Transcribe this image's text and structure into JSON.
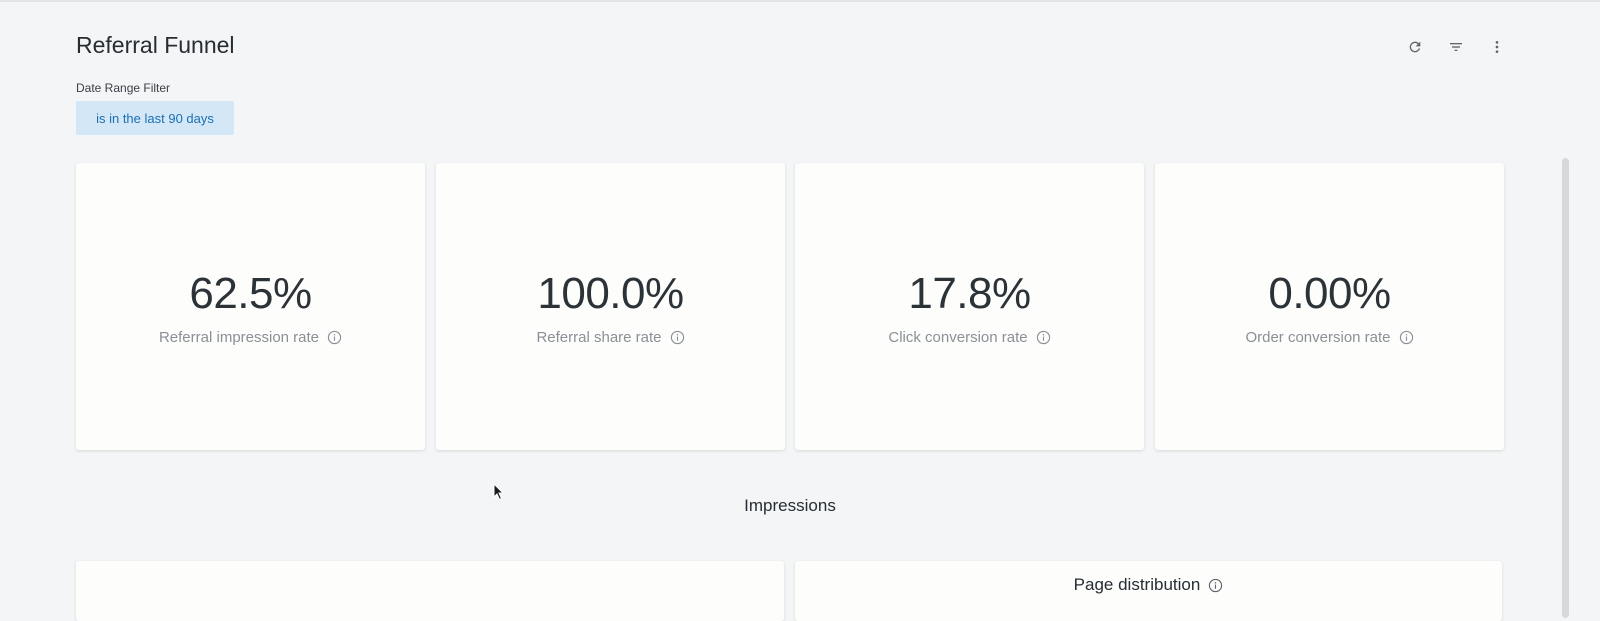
{
  "header": {
    "title": "Referral Funnel",
    "actions": [
      {
        "icon": "refresh-icon"
      },
      {
        "icon": "filter-icon"
      },
      {
        "icon": "more-vertical-icon"
      }
    ]
  },
  "filter": {
    "label": "Date Range Filter",
    "value": "is in the last 90 days"
  },
  "kpis": [
    {
      "value": "62.5%",
      "label": "Referral impression rate",
      "icon": "info-icon"
    },
    {
      "value": "100.0%",
      "label": "Referral share rate",
      "icon": "info-icon"
    },
    {
      "value": "17.8%",
      "label": "Click conversion rate",
      "icon": "info-icon"
    },
    {
      "value": "0.00%",
      "label": "Order conversion rate",
      "icon": "info-icon"
    }
  ],
  "section": {
    "title": "Impressions"
  },
  "panels": [
    {
      "title": ""
    },
    {
      "title": "Page distribution",
      "icon": "info-icon"
    }
  ],
  "colors": {
    "background": "#f4f5f7",
    "card": "#fdfdfc",
    "chip_bg": "#d4e7f7",
    "chip_text": "#1b6fb3",
    "caption": "#8a9096"
  }
}
